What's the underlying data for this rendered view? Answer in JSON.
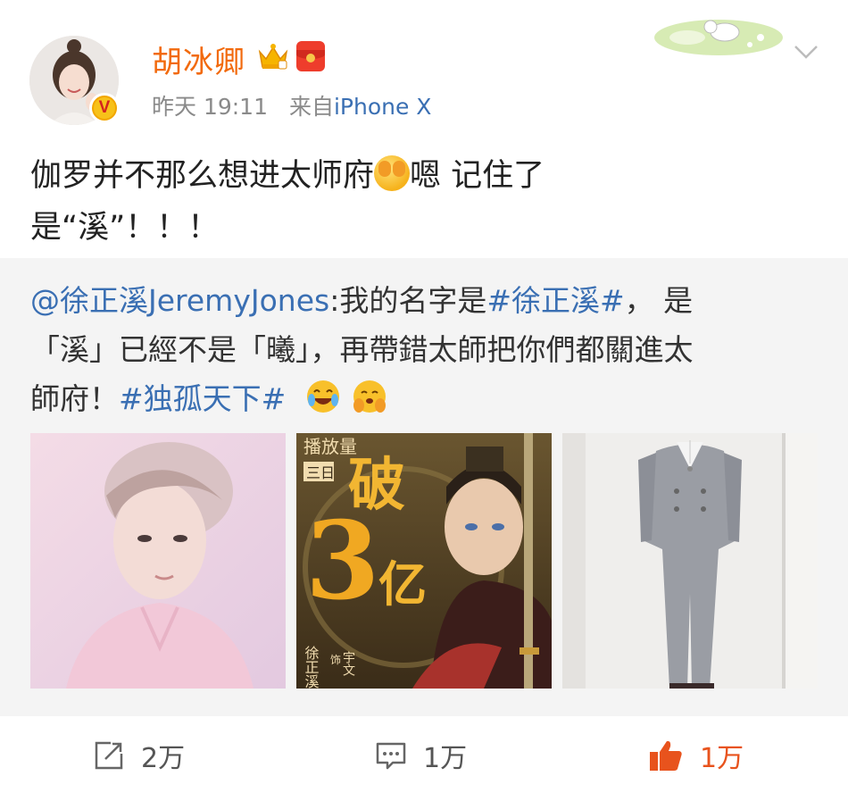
{
  "post": {
    "author": "胡冰卿",
    "time": "昨天 19:11",
    "source_prefix": "来自",
    "device": "iPhone X",
    "text_line1": "伽罗并不那么想进太师府",
    "text_line1b": "嗯 记住了",
    "text_line2": "是“溪”！！！"
  },
  "repost": {
    "mention": "@徐正溪JeremyJones",
    "text_a": ":我的名字是",
    "hashtag1": "#徐正溪#",
    "text_b": "， 是",
    "line2": "「溪」已經不是「曦」，再帶錯太師把你們都關進太",
    "line3_a": "師府！",
    "hashtag2": "#独孤天下#",
    "photos": [
      {
        "name": "portrait-photo"
      },
      {
        "name": "drama-poster",
        "poster_top": "播放量",
        "poster_badge": "三日",
        "poster_big1": "破",
        "poster_big2": "3",
        "poster_big3": "亿",
        "cast_name": "徐正溪",
        "cast_role_prefix": "饰",
        "cast_role": "宇文"
      },
      {
        "name": "suit-photo"
      }
    ]
  },
  "actions": {
    "repost_count": "2万",
    "comment_count": "1万",
    "like_count": "1万"
  },
  "colors": {
    "username": "#f26a0d",
    "link": "#3a6fb3",
    "meta": "#8a8a8a",
    "liked": "#e8531d",
    "repost_bg": "#f4f4f4"
  },
  "icons": [
    "crown-icon",
    "red-packet-icon",
    "chevron-down-icon",
    "v-badge-icon",
    "repost-icon",
    "comment-icon",
    "like-icon",
    "laughing-emoji-icon",
    "shy-emoji-icon"
  ]
}
